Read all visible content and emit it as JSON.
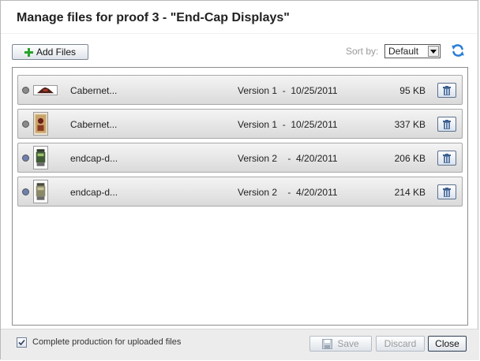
{
  "dialog": {
    "title": "Manage files for proof 3 - \"End-Cap Displays\""
  },
  "toolbar": {
    "add_files_label": "Add Files",
    "add_icon": "plus-icon",
    "sort_label": "Sort by:",
    "sort_value": "Default",
    "refresh_icon": "refresh-icon"
  },
  "files": [
    {
      "name": "Cabernet...",
      "version": "Version 1  -  10/25/2011",
      "size": "95 KB",
      "status_color": "#8a8a8a"
    },
    {
      "name": "Cabernet...",
      "version": "Version 1  -  10/25/2011",
      "size": "337 KB",
      "status_color": "#8a8a8a"
    },
    {
      "name": "endcap-d...",
      "version": "Version 2    -  4/20/2011",
      "size": "206 KB",
      "status_color": "#6f7fb0"
    },
    {
      "name": "endcap-d...",
      "version": "Version 2    -  4/20/2011",
      "size": "214 KB",
      "status_color": "#6f7fb0"
    }
  ],
  "footer": {
    "complete_production_label": "Complete production for uploaded files",
    "complete_production_checked": true,
    "save_label": "Save",
    "discard_label": "Discard",
    "close_label": "Close"
  }
}
